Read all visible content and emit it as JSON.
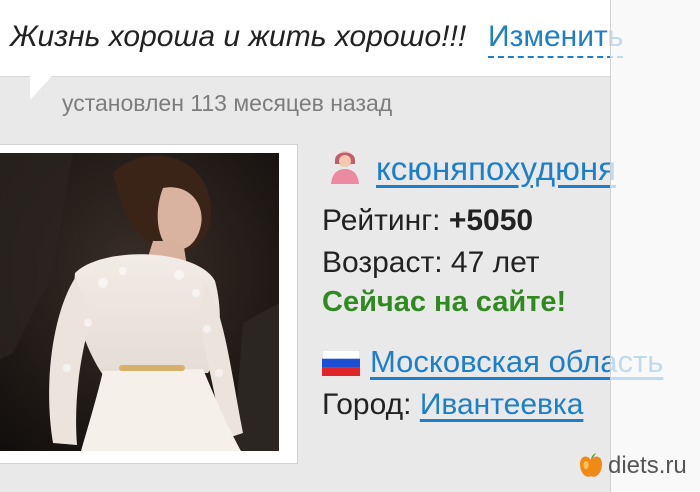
{
  "status": {
    "text": "Жизнь хороша и жить хорошо!!!",
    "edit_label": "Изменить",
    "installed": "установлен 113 месяцев назад"
  },
  "profile": {
    "username": "ксюняпохудюня",
    "rating_label": "Рейтинг: ",
    "rating_value": "+5050",
    "age": "Возраст: 47 лет",
    "online": "Сейчас на сайте!",
    "region": "Московская область",
    "city_label": "Город: ",
    "city": "Ивантеевка",
    "avatar_icon": "female-user-icon",
    "flag_icon": "russia-flag-icon"
  },
  "watermark": {
    "text": "diets.ru",
    "logo_icon": "apple-logo-icon"
  },
  "colors": {
    "link": "#1d7ec9",
    "online": "#2f8a1f",
    "text": "#222222",
    "muted": "#7d7d7d"
  }
}
